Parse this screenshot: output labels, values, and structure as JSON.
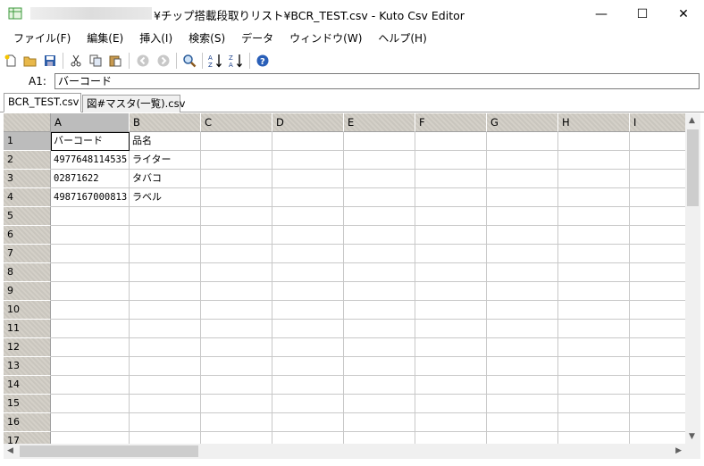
{
  "window": {
    "title": "¥チップ搭載段取りリスト¥BCR_TEST.csv - Kuto Csv Editor",
    "minimize": "—",
    "maximize": "☐",
    "close": "✕"
  },
  "menu": [
    "ファイル(F)",
    "編集(E)",
    "挿入(I)",
    "検索(S)",
    "データ",
    "ウィンドウ(W)",
    "ヘルプ(H)"
  ],
  "toolbar_icons": [
    "new-file-icon",
    "open-folder-icon",
    "save-icon",
    "cut-icon",
    "copy-icon",
    "paste-icon",
    "back-icon",
    "forward-icon",
    "search-icon",
    "sort-ascending-icon",
    "sort-descending-icon",
    "help-icon"
  ],
  "formula": {
    "cell_ref": "A1:",
    "value": "バーコード"
  },
  "tabs": [
    "BCR_TEST.csv",
    "図#マスタ(一覧).csv"
  ],
  "grid": {
    "columns": [
      "A",
      "B",
      "C",
      "D",
      "E",
      "F",
      "G",
      "H",
      "I"
    ],
    "rows": [
      "1",
      "2",
      "3",
      "4",
      "5",
      "6",
      "7",
      "8",
      "9",
      "10",
      "11",
      "12",
      "13",
      "14",
      "15",
      "16",
      "17"
    ],
    "cells": [
      [
        "バーコード",
        "品名"
      ],
      [
        "4977648114535",
        "ライター"
      ],
      [
        "02871622",
        "タバコ"
      ],
      [
        "4987167000813",
        "ラベル"
      ]
    ],
    "selected_cell": "A1"
  },
  "colors": {
    "header_bg": "#d4d0c8",
    "selected_header_bg": "#bcbcbc",
    "gridline": "#c8c8c8"
  }
}
